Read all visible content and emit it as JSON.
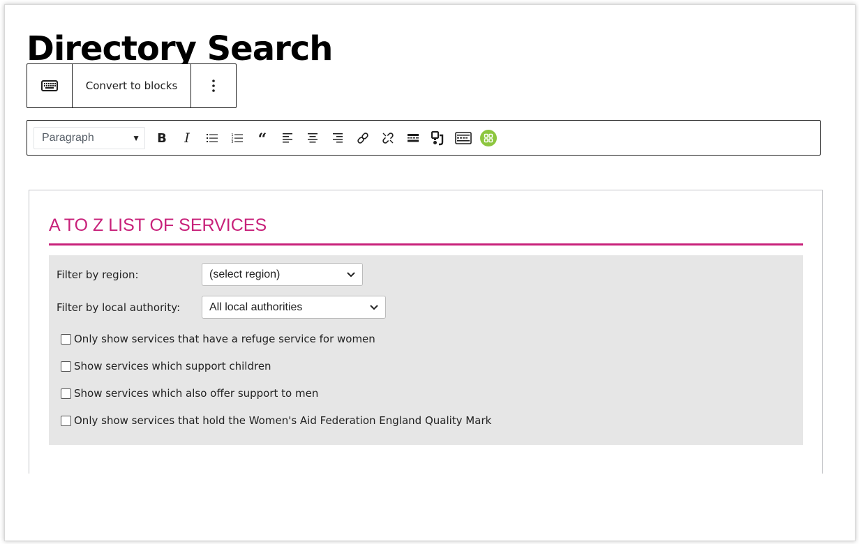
{
  "page": {
    "title": "Directory Search"
  },
  "block_toolbar": {
    "keyboard_icon": "keyboard-icon",
    "convert_label": "Convert to blocks",
    "more_icon": "vertical-ellipsis-icon"
  },
  "classic_toolbar": {
    "format_select": "Paragraph",
    "buttons": [
      "bold-icon",
      "italic-icon",
      "bulleted-list-icon",
      "numbered-list-icon",
      "blockquote-icon",
      "align-left-icon",
      "align-center-icon",
      "align-right-icon",
      "link-icon",
      "unlink-icon",
      "read-more-icon",
      "shortcode-icon",
      "toolbar-toggle-icon",
      "plugin-icon"
    ],
    "plugin_icon_color": "#8dc63f"
  },
  "services": {
    "title": "A TO Z LIST OF SERVICES",
    "accent_color": "#c8217a",
    "filters": {
      "region_label": "Filter by region:",
      "region_value": "(select region)",
      "authority_label": "Filter by local authority:",
      "authority_value": "All local authorities"
    },
    "checkboxes": [
      {
        "label": "Only show services that have a refuge service for women",
        "checked": false
      },
      {
        "label": "Show services which support children",
        "checked": false
      },
      {
        "label": "Show services which also offer support to men",
        "checked": false
      },
      {
        "label": "Only show services that hold the Women's Aid Federation England Quality Mark",
        "checked": false
      }
    ]
  }
}
